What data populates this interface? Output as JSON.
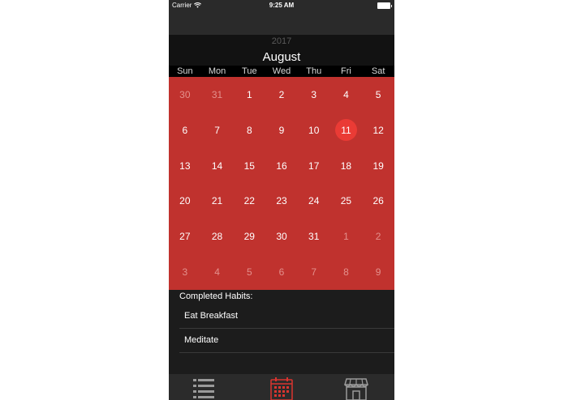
{
  "status_bar": {
    "carrier": "Carrier",
    "time": "9:25 AM"
  },
  "calendar": {
    "year": "2017",
    "month": "August",
    "weekdays": [
      "Sun",
      "Mon",
      "Tue",
      "Wed",
      "Thu",
      "Fri",
      "Sat"
    ],
    "weeks": [
      [
        "30",
        "31",
        "1",
        "2",
        "3",
        "4",
        "5"
      ],
      [
        "6",
        "7",
        "8",
        "9",
        "10",
        "11",
        "12"
      ],
      [
        "13",
        "14",
        "15",
        "16",
        "17",
        "18",
        "19"
      ],
      [
        "20",
        "21",
        "22",
        "23",
        "24",
        "25",
        "26"
      ],
      [
        "27",
        "28",
        "29",
        "30",
        "31",
        "1",
        "2"
      ],
      [
        "3",
        "4",
        "5",
        "6",
        "7",
        "8",
        "9"
      ]
    ],
    "selected_day": "11",
    "colors": {
      "grid": "#c0322e",
      "selected": "#ea3b35",
      "outside_month_text": "#e3908c"
    }
  },
  "habits": {
    "title": "Completed Habits:",
    "items": [
      "Eat Breakfast",
      "Meditate"
    ]
  },
  "tab_bar": {
    "tabs": [
      {
        "icon": "list-icon",
        "active": false
      },
      {
        "icon": "calendar-icon",
        "active": true
      },
      {
        "icon": "store-icon",
        "active": false
      }
    ],
    "active_color": "#d9342f",
    "inactive_color": "#9a9a9a"
  }
}
